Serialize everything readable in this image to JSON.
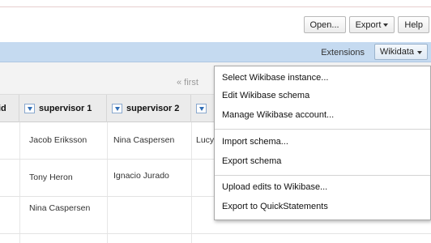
{
  "toolbar": {
    "open_label": "Open...",
    "export_label": "Export",
    "help_label": "Help"
  },
  "extensions": {
    "label": "Extensions",
    "wikidata_label": "Wikidata"
  },
  "pager": {
    "first_label": "« first"
  },
  "columns": [
    {
      "label": "id"
    },
    {
      "label": "supervisor 1"
    },
    {
      "label": "supervisor 2"
    }
  ],
  "rows": [
    {
      "supervisor1": "Jacob Eriksson",
      "supervisor2": "Nina Caspersen",
      "col4": "Lucy"
    },
    {
      "supervisor1": "Tony Heron",
      "supervisor2": "Ignacio Jurado",
      "col4": ""
    },
    {
      "supervisor1": "Nina Caspersen",
      "supervisor2": "",
      "col4": ""
    }
  ],
  "wikidata_menu": {
    "items": [
      "Select Wikibase instance...",
      "Edit Wikibase schema",
      "Manage Wikibase account...",
      "Import schema...",
      "Export schema",
      "Upload edits to Wikibase...",
      "Export to QuickStatements"
    ]
  },
  "colors": {
    "extension_bar": "#c5daf0",
    "dropdown_accent": "#2f6db6"
  }
}
